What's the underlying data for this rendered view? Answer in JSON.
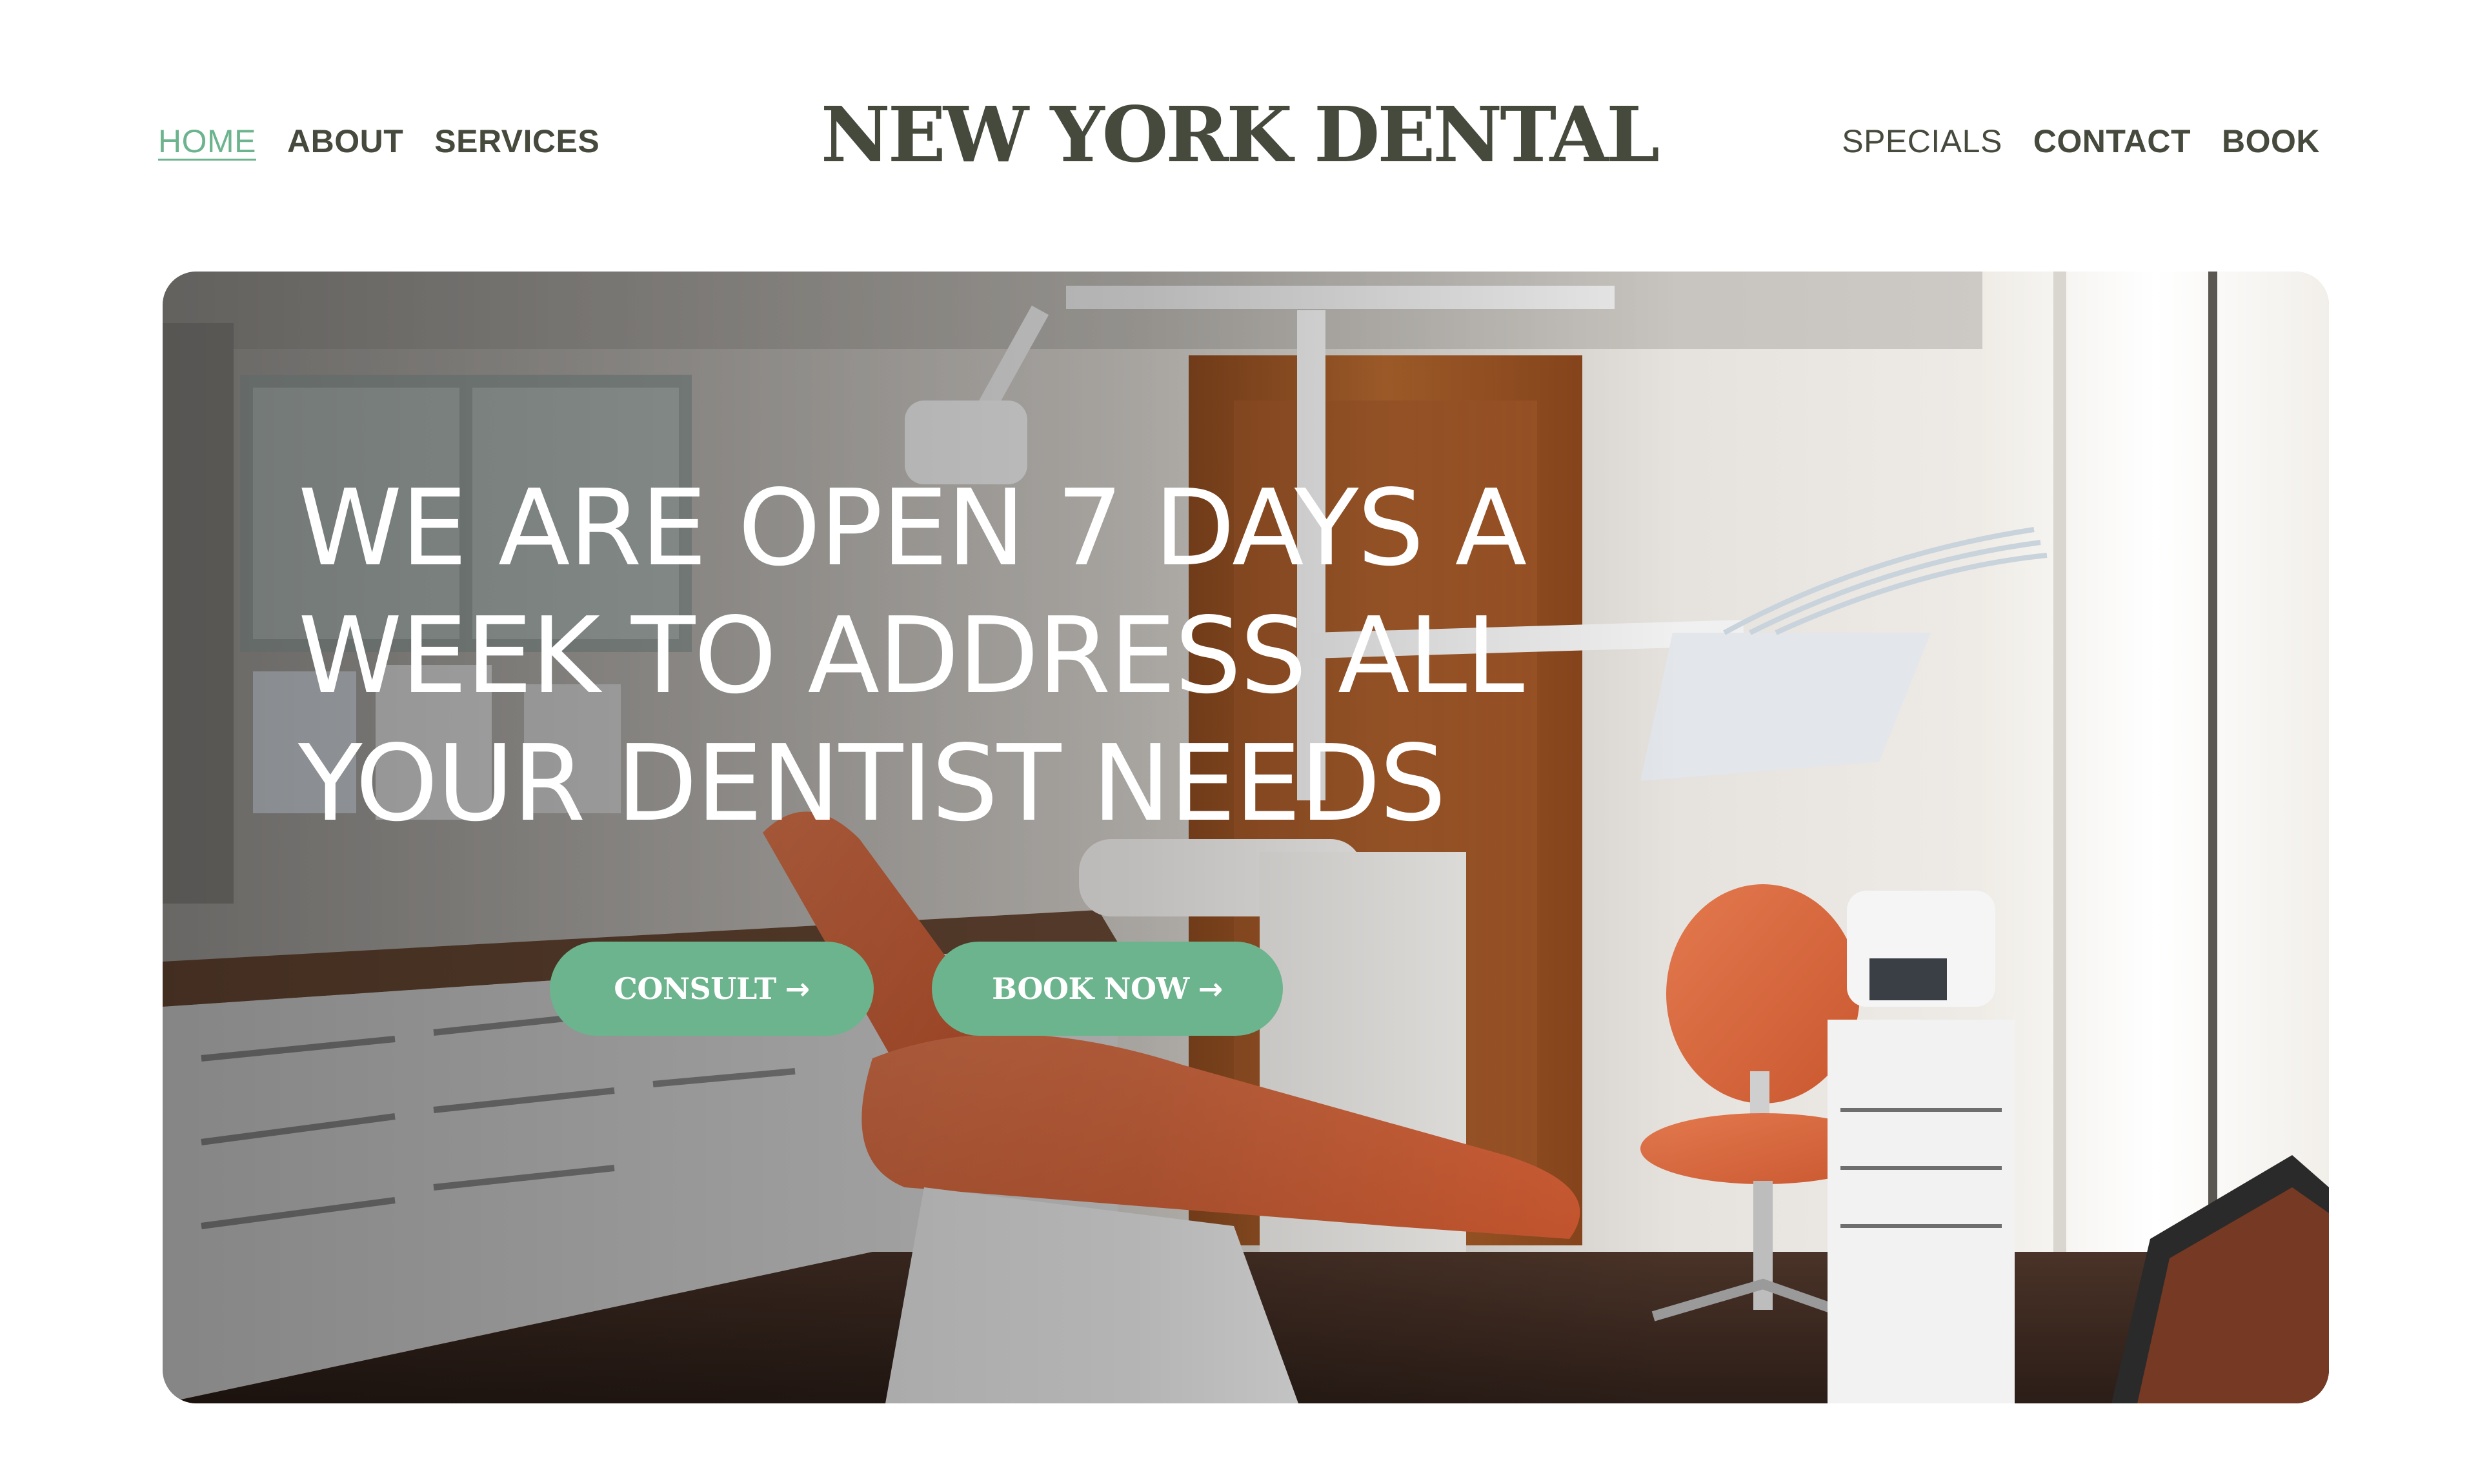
{
  "nav": {
    "left": [
      {
        "label": "HOME",
        "active": true
      },
      {
        "label": "ABOUT"
      },
      {
        "label": "SERVICES"
      }
    ],
    "right": [
      {
        "label": "SPECIALS"
      },
      {
        "label": "CONTACT"
      },
      {
        "label": "BOOK"
      }
    ]
  },
  "brand": {
    "logo": "NEW YORK DENTAL"
  },
  "hero": {
    "heading_lines": [
      "WE ARE OPEN 7 DAYS A",
      "WEEK TO ADDRESS ALL",
      "YOUR DENTIST NEEDS"
    ],
    "consult_label": "CONSULT",
    "book_label": "BOOK NOW",
    "arrow": "→"
  },
  "colors": {
    "accent": "#6cb48d",
    "text_dark": "#454a3d",
    "background": "#ffffff"
  }
}
